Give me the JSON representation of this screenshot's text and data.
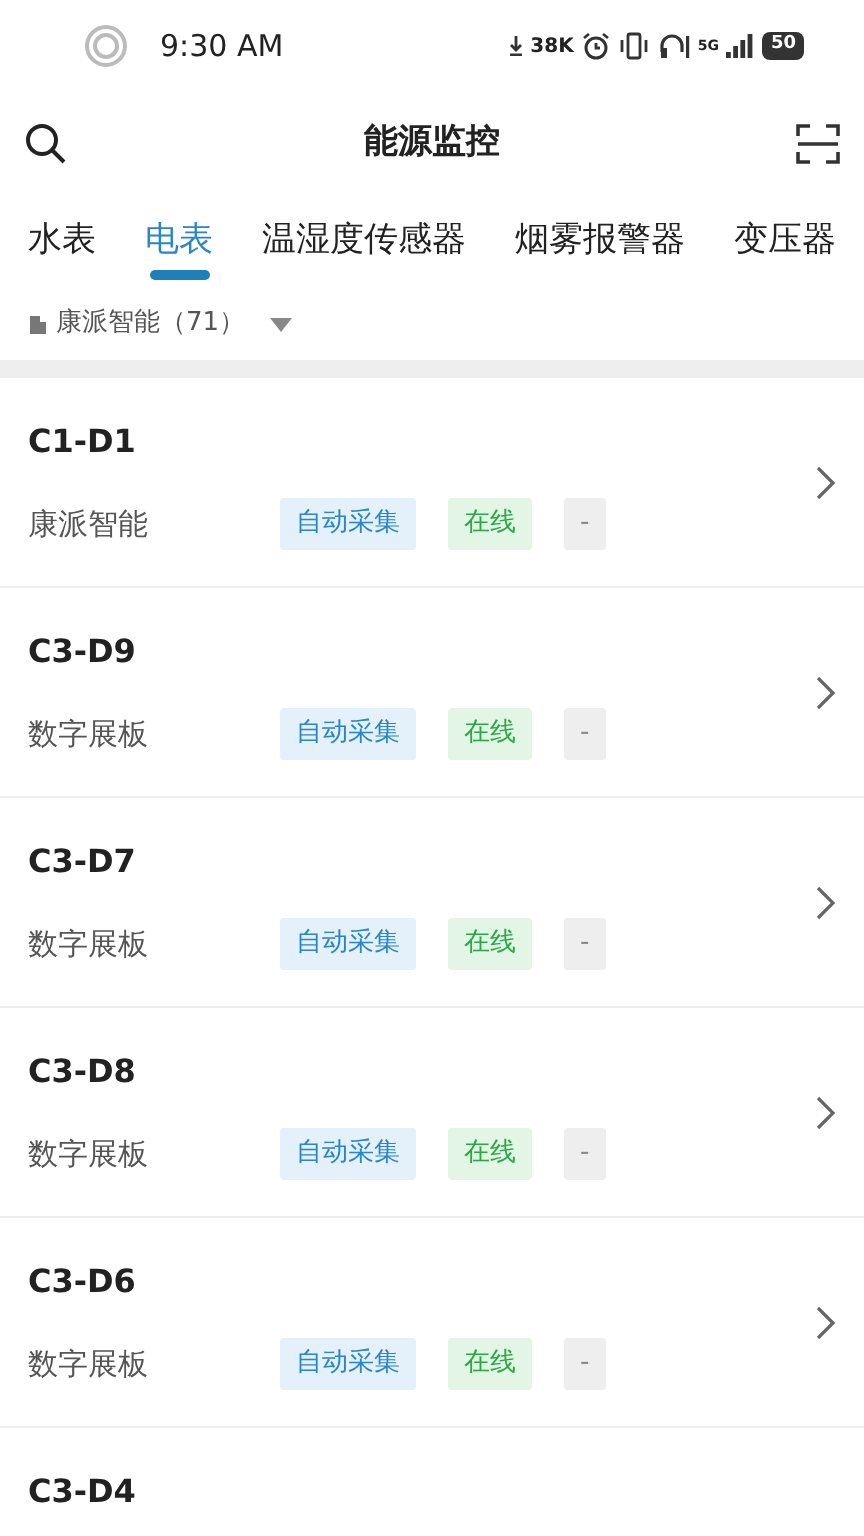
{
  "status_bar": {
    "time": "9:30 AM",
    "net_speed": "38K",
    "network": "5G",
    "battery": "50"
  },
  "header": {
    "title": "能源监控"
  },
  "tabs": [
    {
      "label": "水表",
      "selected": false
    },
    {
      "label": "电表",
      "selected": true
    },
    {
      "label": "温湿度传感器",
      "selected": false
    },
    {
      "label": "烟雾报警器",
      "selected": false
    },
    {
      "label": "变压器",
      "selected": false
    }
  ],
  "filter": {
    "label": "康派智能（71）"
  },
  "devices": [
    {
      "name": "C1-D1",
      "group": "康派智能",
      "tags": [
        {
          "label": "自动采集",
          "kind": "mode"
        },
        {
          "label": "在线",
          "kind": "online"
        },
        {
          "label": "-",
          "kind": "none"
        }
      ]
    },
    {
      "name": "C3-D9",
      "group": "数字展板",
      "tags": [
        {
          "label": "自动采集",
          "kind": "mode"
        },
        {
          "label": "在线",
          "kind": "online"
        },
        {
          "label": "-",
          "kind": "none"
        }
      ]
    },
    {
      "name": "C3-D7",
      "group": "数字展板",
      "tags": [
        {
          "label": "自动采集",
          "kind": "mode"
        },
        {
          "label": "在线",
          "kind": "online"
        },
        {
          "label": "-",
          "kind": "none"
        }
      ]
    },
    {
      "name": "C3-D8",
      "group": "数字展板",
      "tags": [
        {
          "label": "自动采集",
          "kind": "mode"
        },
        {
          "label": "在线",
          "kind": "online"
        },
        {
          "label": "-",
          "kind": "none"
        }
      ]
    },
    {
      "name": "C3-D6",
      "group": "数字展板",
      "tags": [
        {
          "label": "自动采集",
          "kind": "mode"
        },
        {
          "label": "在线",
          "kind": "online"
        },
        {
          "label": "-",
          "kind": "none"
        }
      ]
    },
    {
      "name": "C3-D4"
    }
  ]
}
